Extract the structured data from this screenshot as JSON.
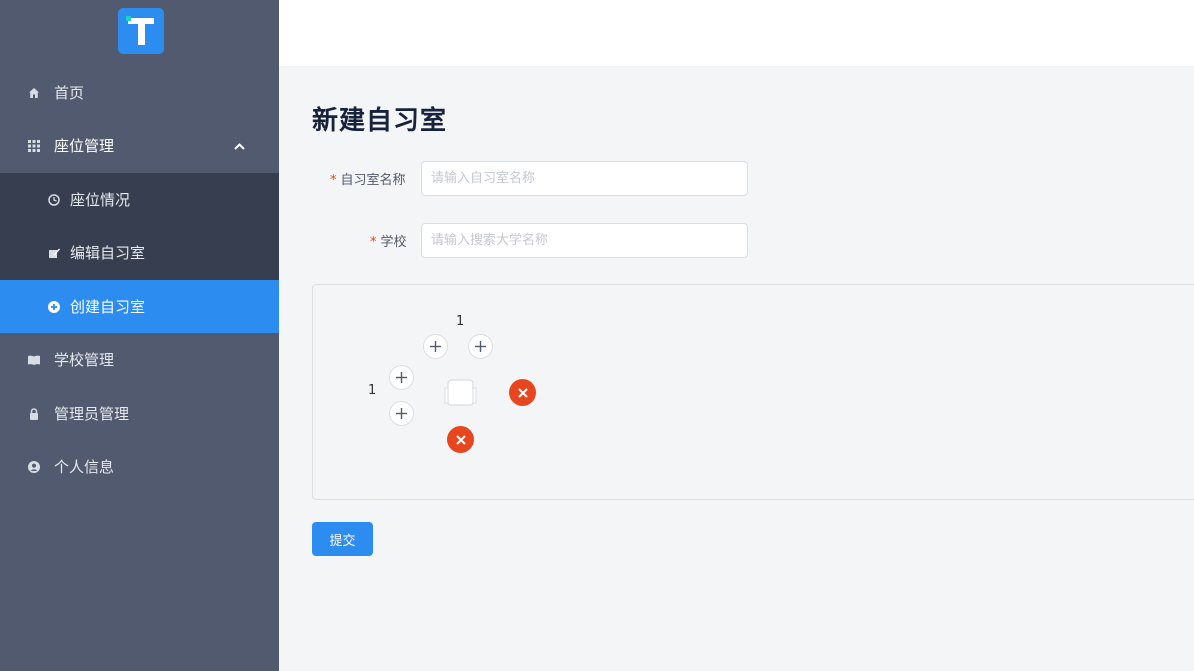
{
  "sidebar": {
    "logo_letter": "T",
    "items": [
      {
        "label": "首页",
        "icon": "home-icon"
      },
      {
        "label": "座位管理",
        "icon": "grid-icon"
      },
      {
        "label": "学校管理",
        "icon": "book-icon"
      },
      {
        "label": "管理员管理",
        "icon": "lock-icon"
      },
      {
        "label": "个人信息",
        "icon": "user-icon"
      }
    ],
    "submenu": [
      {
        "label": "座位情况",
        "icon": "clock-icon"
      },
      {
        "label": "编辑自习室",
        "icon": "edit-icon"
      },
      {
        "label": "创建自习室",
        "icon": "plus-circle-icon"
      }
    ],
    "colors": {
      "bg": "#515a6e",
      "submenu_bg": "#363e4f",
      "active": "#2d8cf0"
    }
  },
  "main": {
    "title": "新建自习室",
    "form": {
      "room_name": {
        "label": "自习室名称",
        "required_mark": "*",
        "placeholder": "请输入自习室名称",
        "value": ""
      },
      "school": {
        "label": "学校",
        "required_mark": "*",
        "placeholder": "请输入搜索大学名称",
        "value": ""
      }
    },
    "seat_editor": {
      "column_count": "1",
      "row_count": "1"
    },
    "submit_label": "提交"
  },
  "colors": {
    "primary": "#2d8cf0",
    "danger": "#e8461e",
    "page_bg": "#f4f5f7"
  }
}
